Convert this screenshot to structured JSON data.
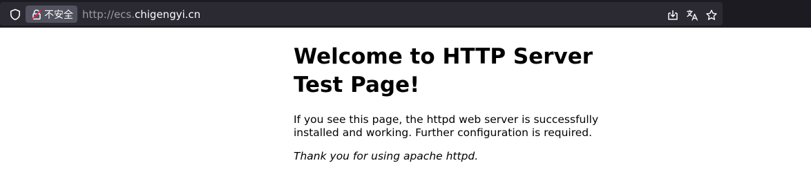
{
  "browser": {
    "security_label": "不安全",
    "url_scheme": "http://ecs.",
    "url_host": "chigengyi.cn",
    "icons": [
      "shield-icon",
      "lock-warning-icon",
      "save-page-icon",
      "translate-icon",
      "bookmark-star-icon"
    ]
  },
  "page": {
    "heading": "Welcome to HTTP Server Test Page!",
    "paragraph": "If you see this page, the httpd web server is successfully installed and working. Further configuration is required.",
    "thanks": "Thank you for using apache httpd."
  }
}
